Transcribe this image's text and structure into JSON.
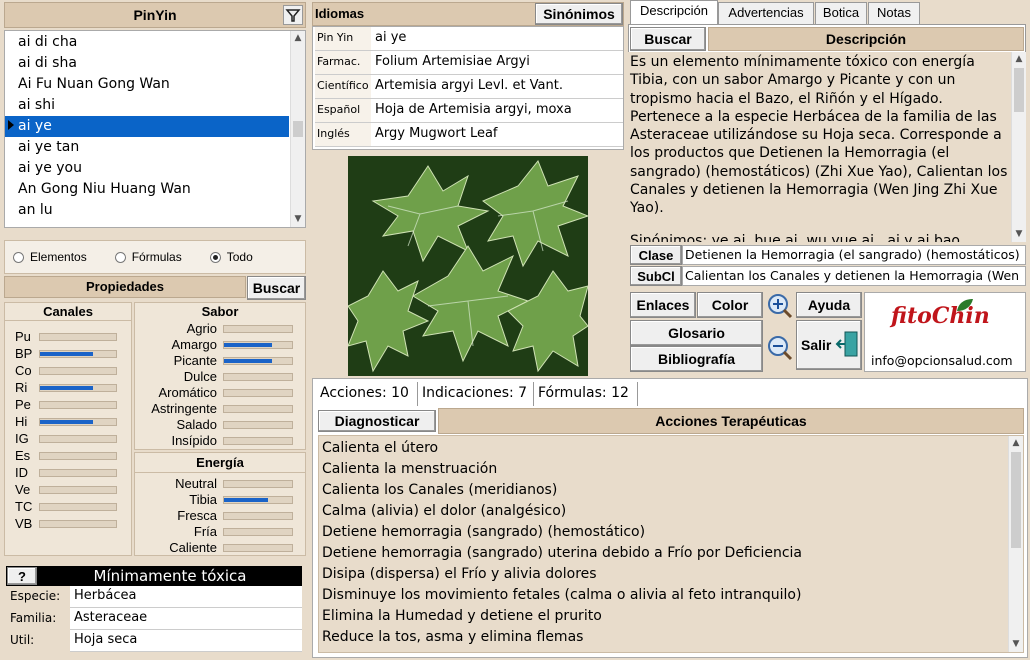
{
  "pinyin": {
    "title": "PinYin",
    "items": [
      "ai di cha",
      "ai di sha",
      "Ai Fu Nuan Gong Wan",
      "ai shi",
      "ai ye",
      "ai ye tan",
      "ai ye you",
      "An Gong Niu Huang Wan",
      "an lu"
    ],
    "selected_index": 4
  },
  "filter": {
    "options": [
      "Elementos",
      "Fórmulas",
      "Todo"
    ],
    "selected": "Todo"
  },
  "propiedades": {
    "title": "Propiedades",
    "buscar": "Buscar",
    "canales_title": "Canales",
    "canales": [
      {
        "label": "Pu",
        "level": 0
      },
      {
        "label": "BP",
        "level": 0.7
      },
      {
        "label": "Co",
        "level": 0
      },
      {
        "label": "Ri",
        "level": 0.7
      },
      {
        "label": "Pe",
        "level": 0
      },
      {
        "label": "Hi",
        "level": 0.7
      },
      {
        "label": "IG",
        "level": 0
      },
      {
        "label": "Es",
        "level": 0
      },
      {
        "label": "ID",
        "level": 0
      },
      {
        "label": "Ve",
        "level": 0
      },
      {
        "label": "TC",
        "level": 0
      },
      {
        "label": "VB",
        "level": 0
      }
    ],
    "sabor_title": "Sabor",
    "sabor": [
      {
        "label": "Agrio",
        "level": 0
      },
      {
        "label": "Amargo",
        "level": 0.7
      },
      {
        "label": "Picante",
        "level": 0.7
      },
      {
        "label": "Dulce",
        "level": 0
      },
      {
        "label": "Aromático",
        "level": 0
      },
      {
        "label": "Astringente",
        "level": 0
      },
      {
        "label": "Salado",
        "level": 0
      },
      {
        "label": "Insípido",
        "level": 0
      }
    ],
    "energia_title": "Energía",
    "energia": [
      {
        "label": "Neutral",
        "level": 0
      },
      {
        "label": "Tibia",
        "level": 0.65
      },
      {
        "label": "Fresca",
        "level": 0
      },
      {
        "label": "Fría",
        "level": 0
      },
      {
        "label": "Caliente",
        "level": 0
      }
    ]
  },
  "toxicidad": {
    "help": "?",
    "label": "Mínimamente tóxica"
  },
  "especie": {
    "label": "Especie:",
    "value": "Herbácea"
  },
  "familia": {
    "label": "Familia:",
    "value": "Asteraceae"
  },
  "util": {
    "label": "Util:",
    "value": "Hoja seca"
  },
  "idiomas": {
    "title": "Idiomas",
    "sinonimos": "Sinónimos",
    "rows": [
      {
        "label": "Pin Yin",
        "value": "ai ye"
      },
      {
        "label": "Farmac.",
        "value": "Folium Artemisiae Argyi"
      },
      {
        "label": "Científico",
        "value": "Artemisia argyi Levl. et Vant."
      },
      {
        "label": "Español",
        "value": "Hoja de Artemisia argyi, moxa"
      },
      {
        "label": "Inglés",
        "value": "Argy Mugwort Leaf"
      }
    ]
  },
  "tabs": [
    "Descripción",
    "Advertencias",
    "Botica",
    "Notas"
  ],
  "descripcion": {
    "buscar": "Buscar",
    "title": "Descripción",
    "text": "Es un elemento mínimamente tóxico con energía Tibia, con un sabor Amargo y Picante y con un tropismo hacia el Bazo, el Riñón y el Hígado. Pertenece a la especie Herbácea de la familia de las Asteraceae utilizándose su Hoja seca. Corresponde a los productos que Detienen la Hemorragia (el sangrado) (hemostáticos) (Zhi Xue Yao), Calientan los Canales y detienen la Hemorragia (Wen Jing Zhi Xue Yao).",
    "more": "Sinónimos: ye ai, bue ai, wu yue ai , ai y ai bao"
  },
  "clase": {
    "label": "Clase",
    "value": "Detienen la Hemorragia (el sangrado) (hemostáticos)"
  },
  "subcl": {
    "label": "SubCl",
    "value": "Calientan los Canales y detienen la Hemorragia (Wen"
  },
  "buttons": {
    "enlaces": "Enlaces",
    "color": "Color",
    "ayuda": "Ayuda",
    "glosario": "Glosario",
    "salir": "Salir",
    "bibliografia": "Bibliografía"
  },
  "logo": {
    "brand": "fitoChin",
    "email": "info@opcionsalud.com"
  },
  "lower_tabs": [
    "Acciones: 10",
    "Indicaciones: 7",
    "Fórmulas: 12"
  ],
  "acciones": {
    "diagnosticar": "Diagnosticar",
    "title": "Acciones Terapéuticas",
    "items": [
      "Calienta el útero",
      "Calienta la menstruación",
      "Calienta los Canales (meridianos)",
      "Calma (alivia) el dolor (analgésico)",
      "Detiene hemorragia (sangrado) (hemostático)",
      "Detiene hemorragia (sangrado) uterina debido a Frío por Deficiencia",
      "Disipa (dispersa) el Frío y alivia dolores",
      "Disminuye los movimiento fetales (calma o alivia al feto intranquilo)",
      "Elimina la Humedad y detiene el prurito",
      "Reduce la tos, asma y elimina flemas"
    ]
  },
  "colors": {
    "accent": "#0a64c8",
    "panel": "#e8dccb",
    "header": "#dcc9b0",
    "logo_red": "#c0151b",
    "logo_green": "#2a7a2a"
  }
}
